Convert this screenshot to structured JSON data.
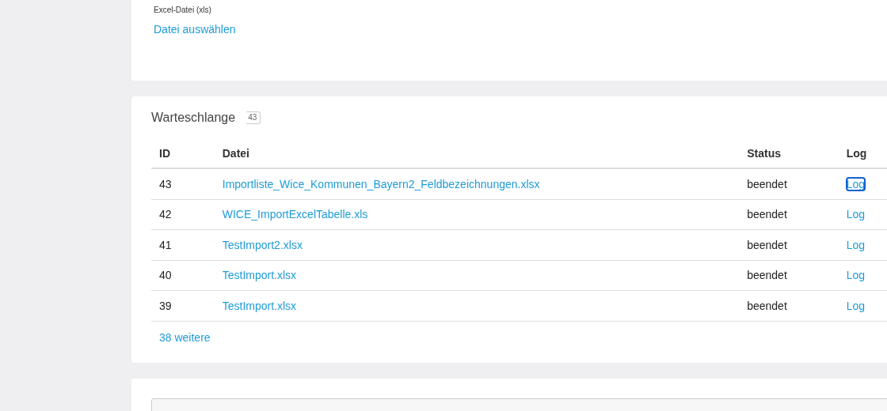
{
  "upload": {
    "label": "Excel-Datei (xls)",
    "link": "Datei auswählen"
  },
  "queue": {
    "title": "Warteschlange",
    "count": "43",
    "columns": [
      "ID",
      "Datei",
      "Status",
      "Log"
    ],
    "rows": [
      {
        "id": "43",
        "file": "Importliste_Wice_Kommunen_Bayern2_Feldbezeichnungen.xlsx",
        "status": "beendet",
        "log": "Log",
        "focused": true
      },
      {
        "id": "42",
        "file": "WICE_ImportExcelTabelle.xls",
        "status": "beendet",
        "log": "Log",
        "focused": false
      },
      {
        "id": "41",
        "file": "TestImport2.xlsx",
        "status": "beendet",
        "log": "Log",
        "focused": false
      },
      {
        "id": "40",
        "file": "TestImport.xlsx",
        "status": "beendet",
        "log": "Log",
        "focused": false
      },
      {
        "id": "39",
        "file": "TestImport.xlsx",
        "status": "beendet",
        "log": "Log",
        "focused": false
      }
    ],
    "more": "38 weitere"
  }
}
